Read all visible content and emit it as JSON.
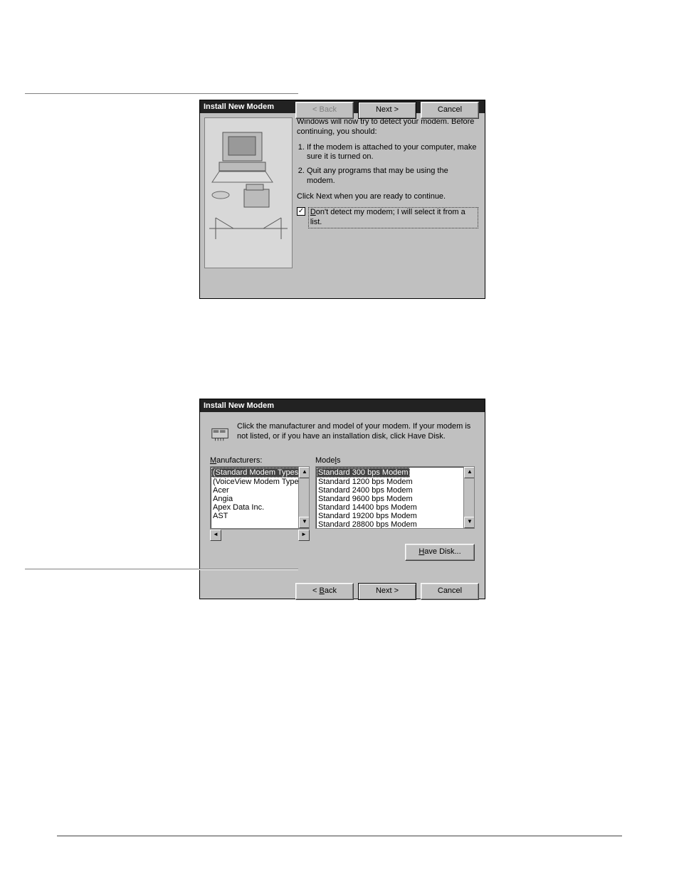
{
  "dialog1": {
    "title": "Install New Modem",
    "intro": "Windows will now try to detect your modem. Before continuing, you should:",
    "steps": {
      "1": "If the modem is attached to your computer, make sure it is turned on.",
      "2": "Quit any programs that may be using the modem."
    },
    "prompt": "Click Next when you are ready to continue.",
    "checkbox": {
      "checked": true,
      "prefix": "D",
      "label": "on't detect my modem; I will select it from a list."
    },
    "buttons": {
      "back": "< Back",
      "next": "Next >",
      "cancel": "Cancel"
    },
    "back_disabled": true
  },
  "dialog2": {
    "title": "Install New Modem",
    "header": "Click the manufacturer and model of your modem. If your modem is not listed, or if you have an installation disk, click Have Disk.",
    "labels": {
      "manufacturers_prefix": "M",
      "manufacturers": "anufacturers:",
      "models_prefix": "",
      "models_before": "Mode",
      "models_u": "l",
      "models_after": "s"
    },
    "manufacturers": [
      "(Standard Modem Types)",
      "(VoiceView Modem Types)",
      "Acer",
      "Angia",
      "Apex Data Inc.",
      "AST"
    ],
    "selected_manufacturer_index": 0,
    "models": [
      "Standard   300 bps Modem",
      "Standard  1200 bps Modem",
      "Standard  2400 bps Modem",
      "Standard  9600 bps Modem",
      "Standard 14400 bps Modem",
      "Standard 19200 bps Modem",
      "Standard 28800 bps Modem"
    ],
    "selected_model_index": 0,
    "buttons": {
      "have_disk_prefix": "H",
      "have_disk": "ave Disk...",
      "back_prefix": "B",
      "back": "ack",
      "next": "Next >",
      "cancel": "Cancel"
    }
  }
}
